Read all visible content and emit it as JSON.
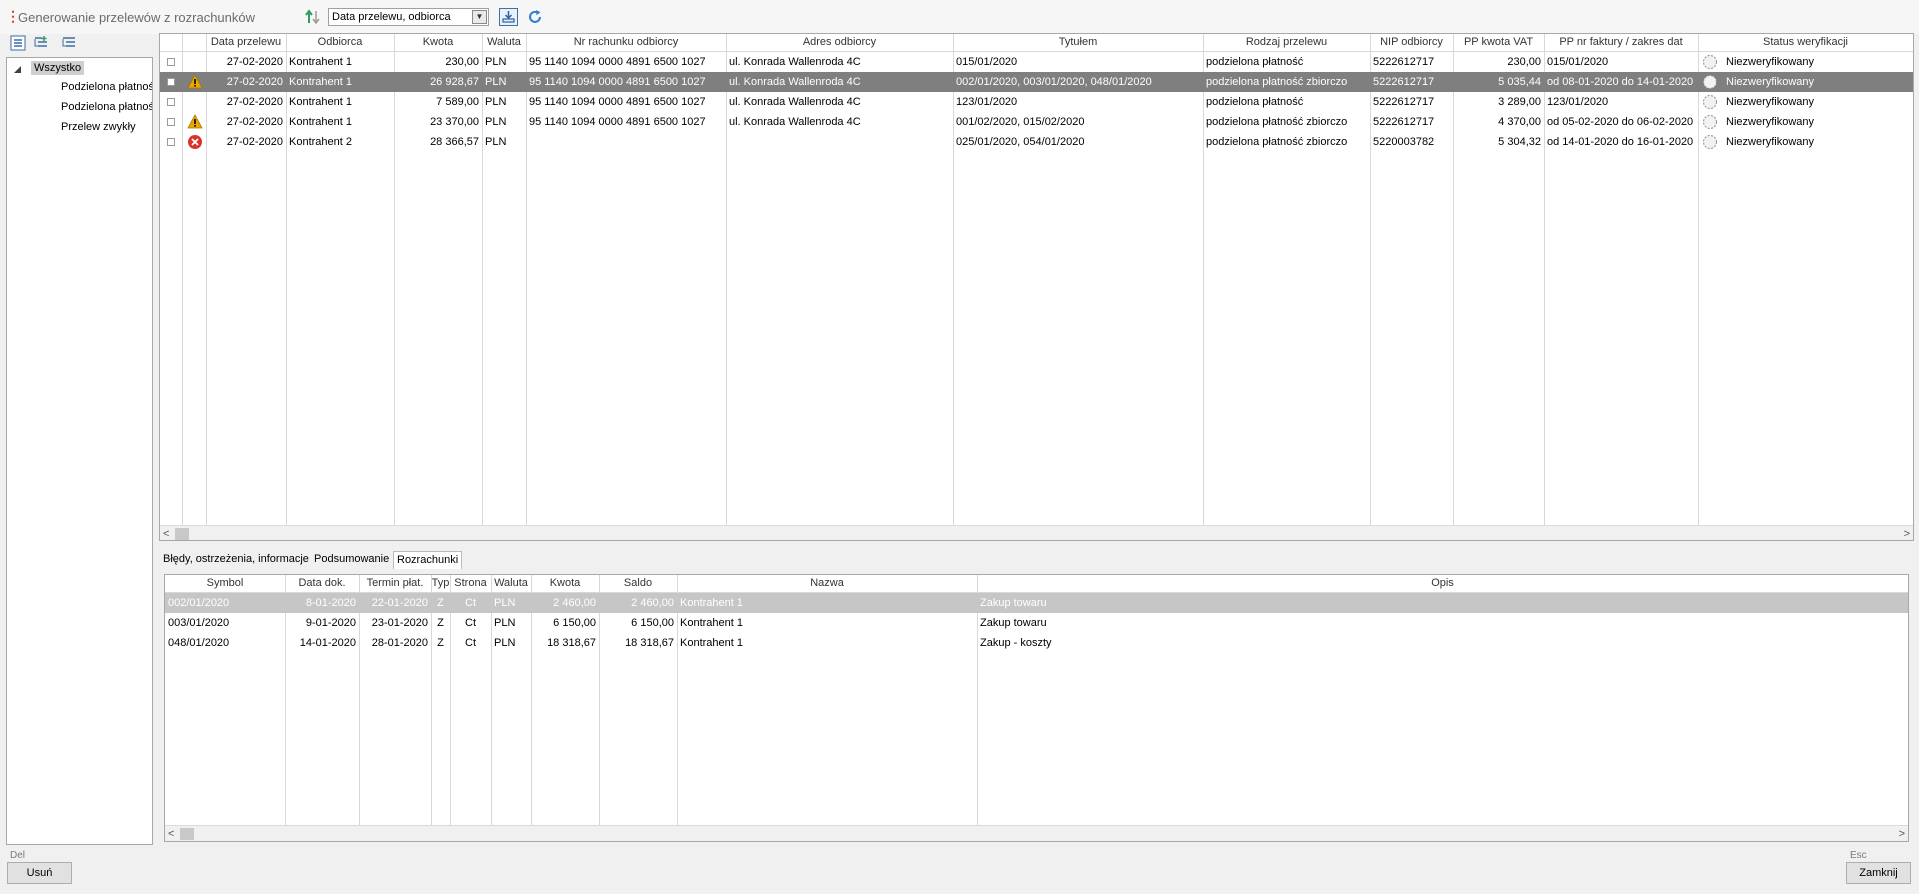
{
  "window": {
    "title": "Generowanie przelewów z rozrachunków"
  },
  "toolbar": {
    "sort_combo_value": "Data przelewu, odbiorca",
    "icons": [
      "sort-arrows-icon",
      "export-icon",
      "refresh-icon"
    ]
  },
  "sidebar": {
    "tools": [
      "expand-all-icon",
      "add-node-icon",
      "collapse-all-icon"
    ],
    "tree": {
      "root": "Wszystko",
      "children": [
        "Podzielona płatność",
        "Podzielona płatność",
        "Przelew zwykły"
      ]
    }
  },
  "transfers": {
    "columns": [
      "",
      "",
      "Data przelewu",
      "Odbiorca",
      "Kwota",
      "Waluta",
      "Nr rachunku odbiorcy",
      "Adres odbiorcy",
      "Tytułem",
      "Rodzaj przelewu",
      "NIP odbiorcy",
      "PP kwota VAT",
      "PP nr faktury / zakres dat",
      "Status weryfikacji"
    ],
    "selected_row": 1,
    "rows": [
      {
        "icon": "",
        "date": "27-02-2020",
        "recipient": "Kontrahent 1",
        "amount": "230,00",
        "currency": "PLN",
        "account": "95 1140 1094 0000 4891 6500 1027",
        "address": "ul. Konrada Wallenroda 4C",
        "title": "015/01/2020",
        "type": "podzielona płatność",
        "nip": "5222612717",
        "vat": "230,00",
        "invoice": "015/01/2020",
        "status": "Niezweryfikowany"
      },
      {
        "icon": "warning",
        "date": "27-02-2020",
        "recipient": "Kontrahent 1",
        "amount": "26 928,67",
        "currency": "PLN",
        "account": "95 1140 1094 0000 4891 6500 1027",
        "address": "ul. Konrada Wallenroda 4C",
        "title": "002/01/2020, 003/01/2020, 048/01/2020",
        "type": "podzielona płatność zbiorczo",
        "nip": "5222612717",
        "vat": "5 035,44",
        "invoice": "od 08-01-2020 do 14-01-2020",
        "status": "Niezweryfikowany"
      },
      {
        "icon": "",
        "date": "27-02-2020",
        "recipient": "Kontrahent 1",
        "amount": "7 589,00",
        "currency": "PLN",
        "account": "95 1140 1094 0000 4891 6500 1027",
        "address": "ul. Konrada Wallenroda 4C",
        "title": "123/01/2020",
        "type": "podzielona płatność",
        "nip": "5222612717",
        "vat": "3 289,00",
        "invoice": "123/01/2020",
        "status": "Niezweryfikowany"
      },
      {
        "icon": "warning",
        "date": "27-02-2020",
        "recipient": "Kontrahent 1",
        "amount": "23 370,00",
        "currency": "PLN",
        "account": "95 1140 1094 0000 4891 6500 1027",
        "address": "ul. Konrada Wallenroda 4C",
        "title": "001/02/2020, 015/02/2020",
        "type": "podzielona płatność zbiorczo",
        "nip": "5222612717",
        "vat": "4 370,00",
        "invoice": "od 05-02-2020 do 06-02-2020",
        "status": "Niezweryfikowany"
      },
      {
        "icon": "error",
        "date": "27-02-2020",
        "recipient": "Kontrahent 2",
        "amount": "28 366,57",
        "currency": "PLN",
        "account": "",
        "address": "",
        "title": "025/01/2020, 054/01/2020",
        "type": "podzielona płatność zbiorczo",
        "nip": "5220003782",
        "vat": "5 304,32",
        "invoice": "od 14-01-2020 do 16-01-2020",
        "status": "Niezweryfikowany"
      }
    ]
  },
  "tabs": [
    {
      "label": "Błędy, ostrzeżenia, informacje",
      "active": false
    },
    {
      "label": "Podsumowanie",
      "active": false
    },
    {
      "label": "Rozrachunki",
      "active": true
    }
  ],
  "settlements": {
    "columns": [
      "Symbol",
      "Data dok.",
      "Termin płat.",
      "Typ",
      "Strona",
      "Waluta",
      "Kwota",
      "Saldo",
      "Nazwa",
      "Opis"
    ],
    "selected_row": 0,
    "rows": [
      {
        "symbol": "002/01/2020",
        "doc_date": "8-01-2020",
        "due_date": "22-01-2020",
        "type": "Z",
        "side": "Ct",
        "currency": "PLN",
        "amount": "2 460,00",
        "balance": "2 460,00",
        "name": "Kontrahent 1",
        "desc": "Zakup towaru"
      },
      {
        "symbol": "003/01/2020",
        "doc_date": "9-01-2020",
        "due_date": "23-01-2020",
        "type": "Z",
        "side": "Ct",
        "currency": "PLN",
        "amount": "6 150,00",
        "balance": "6 150,00",
        "name": "Kontrahent 1",
        "desc": "Zakup towaru"
      },
      {
        "symbol": "048/01/2020",
        "doc_date": "14-01-2020",
        "due_date": "28-01-2020",
        "type": "Z",
        "side": "Ct",
        "currency": "PLN",
        "amount": "18 318,67",
        "balance": "18 318,67",
        "name": "Kontrahent 1",
        "desc": "Zakup - koszty"
      }
    ]
  },
  "footer": {
    "delete_shortcut": "Del",
    "delete_label": "Usuń",
    "close_shortcut": "Esc",
    "close_label": "Zamknij"
  },
  "colors": {
    "accent_title": "#d2402b",
    "selected_row": "#7f7f7f",
    "warning": "#e7a800",
    "error": "#d9342b"
  }
}
